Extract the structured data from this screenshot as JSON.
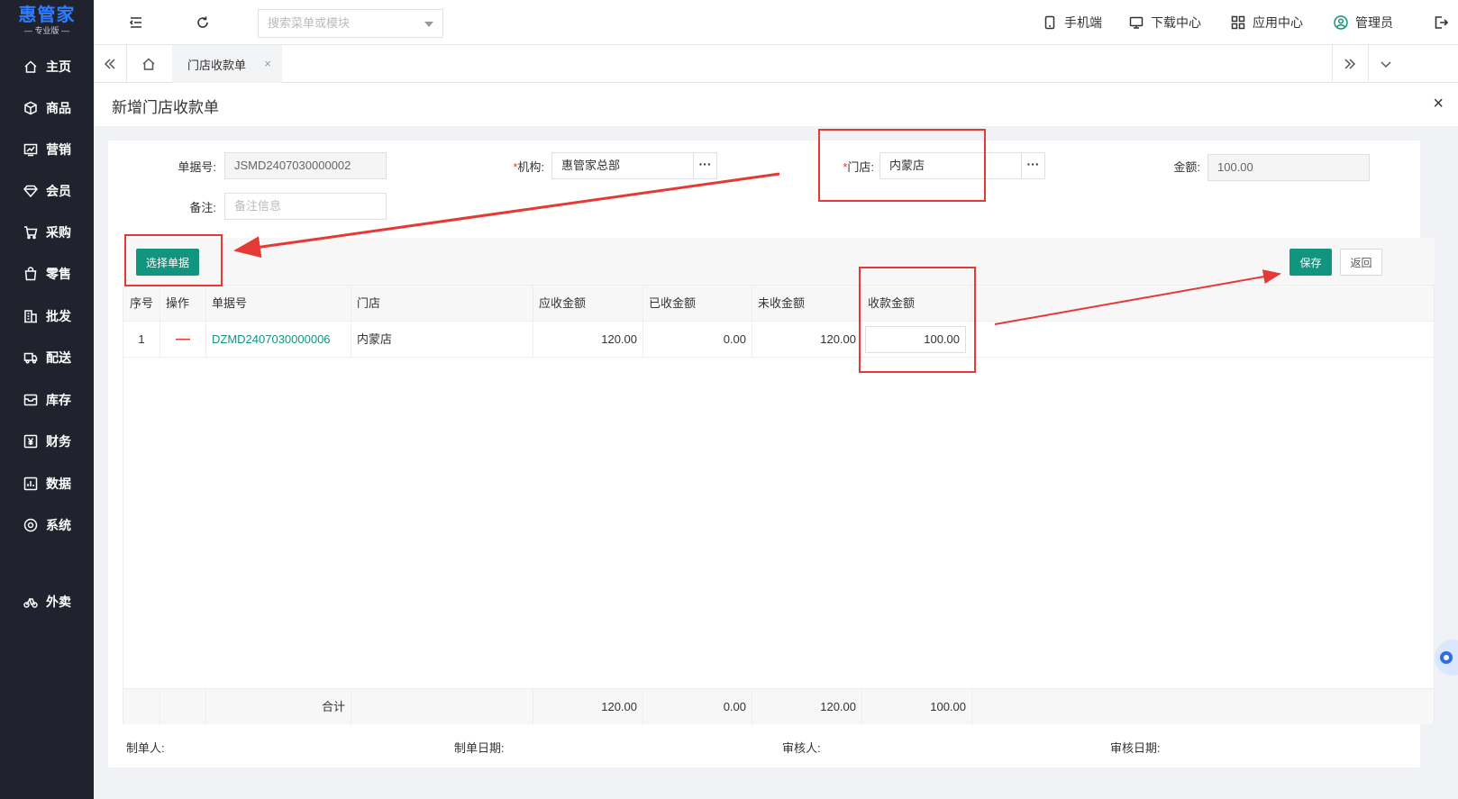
{
  "logo": {
    "brand": "惠管家",
    "edition": "— 专业版 —"
  },
  "sidebar": {
    "items": [
      {
        "label": "主页",
        "icon": "home-icon"
      },
      {
        "label": "商品",
        "icon": "box-icon"
      },
      {
        "label": "营销",
        "icon": "chart-icon"
      },
      {
        "label": "会员",
        "icon": "diamond-icon"
      },
      {
        "label": "采购",
        "icon": "cart-icon"
      },
      {
        "label": "零售",
        "icon": "bag-icon"
      },
      {
        "label": "批发",
        "icon": "building-icon"
      },
      {
        "label": "配送",
        "icon": "truck-icon"
      },
      {
        "label": "库存",
        "icon": "inbox-icon"
      },
      {
        "label": "财务",
        "icon": "yen-icon"
      },
      {
        "label": "数据",
        "icon": "data-icon"
      },
      {
        "label": "系统",
        "icon": "settings-icon"
      },
      {
        "label": "外卖",
        "icon": "bike-icon"
      }
    ]
  },
  "header": {
    "search_placeholder": "搜索菜单或模块",
    "links": {
      "mobile": "手机端",
      "download": "下载中心",
      "apps": "应用中心",
      "user": "管理员"
    }
  },
  "tabs": {
    "active": "门店收款单",
    "close": "×"
  },
  "page": {
    "title": "新增门店收款单",
    "close": "×"
  },
  "form": {
    "doc_no_label": "单据号:",
    "doc_no_value": "JSMD2407030000002",
    "org_label": "机构:",
    "org_value": "惠管家总部",
    "store_label": "门店:",
    "store_value": "内蒙店",
    "amount_label": "金额:",
    "amount_value": "100.00",
    "remark_label": "备注:",
    "remark_placeholder": "备注信息",
    "required_mark": "*",
    "dots": "···"
  },
  "toolbar": {
    "select_docs": "选择单据",
    "save": "保存",
    "back": "返回"
  },
  "grid": {
    "headers": {
      "seq": "序号",
      "op": "操作",
      "doc_no": "单据号",
      "store": "门店",
      "receivable": "应收金额",
      "received": "已收金额",
      "unreceived": "未收金额",
      "collect": "收款金额"
    },
    "rows": [
      {
        "seq": "1",
        "op": "—",
        "doc_no": "DZMD2407030000006",
        "store": "内蒙店",
        "receivable": "120.00",
        "received": "0.00",
        "unreceived": "120.00",
        "collect": "100.00"
      }
    ],
    "footer": {
      "label": "合计",
      "receivable": "120.00",
      "received": "0.00",
      "unreceived": "120.00",
      "collect": "100.00"
    }
  },
  "sign": {
    "maker": "制单人:",
    "make_date": "制单日期:",
    "auditor": "审核人:",
    "audit_date": "审核日期:"
  },
  "colors": {
    "sidebar_bg": "#20232e",
    "accent": "#12957f",
    "brand": "#2f7dff",
    "annotation": "#e53935"
  }
}
